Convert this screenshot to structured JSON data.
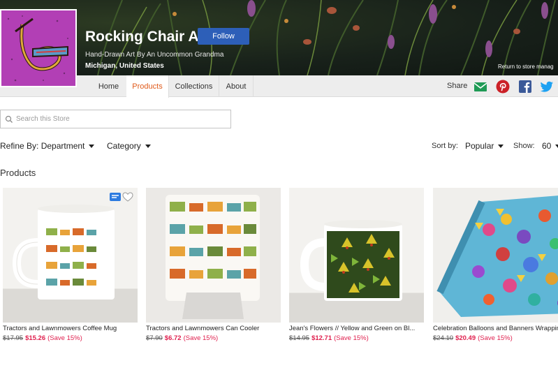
{
  "header": {
    "store_name": "Rocking Chair Art",
    "follow_label": "Follow",
    "tagline": "Hand-Drawn Art By An Uncommon Grandma",
    "location": "Michigan, United States",
    "return_link": "Return to store manag"
  },
  "nav": {
    "tabs": [
      {
        "label": "Home"
      },
      {
        "label": "Products",
        "active": true
      },
      {
        "label": "Collections"
      },
      {
        "label": "About"
      }
    ],
    "share_label": "Share",
    "social_icons": [
      "email-icon",
      "pinterest-icon",
      "facebook-icon",
      "twitter-icon"
    ]
  },
  "search": {
    "placeholder": "Search this Store"
  },
  "filters": {
    "department_label": "Refine By: Department",
    "category_label": "Category",
    "sort_by_label": "Sort by:",
    "sort_value": "Popular",
    "show_label": "Show:",
    "show_value": "60"
  },
  "section_title": "Products",
  "products": [
    {
      "title": "Tractors and Lawnmowers Coffee Mug",
      "old_price": "$17.95",
      "new_price": "$15.26",
      "save": "(Save 15%)"
    },
    {
      "title": "Tractors and Lawnmowers Can Cooler",
      "old_price": "$7.90",
      "new_price": "$6.72",
      "save": "(Save 15%)"
    },
    {
      "title": "Jean's Flowers // Yellow and Green on Bl...",
      "old_price": "$14.95",
      "new_price": "$12.71",
      "save": "(Save 15%)"
    },
    {
      "title": "Celebration Balloons and Banners Wrapping Paper",
      "old_price": "$24.10",
      "new_price": "$20.49",
      "save": "(Save 15%)"
    }
  ],
  "colors": {
    "accent_orange": "#e05a1a",
    "follow_blue": "#2d5fb8",
    "sale_red": "#e0214f",
    "logo_purple": "#b23fb5"
  }
}
